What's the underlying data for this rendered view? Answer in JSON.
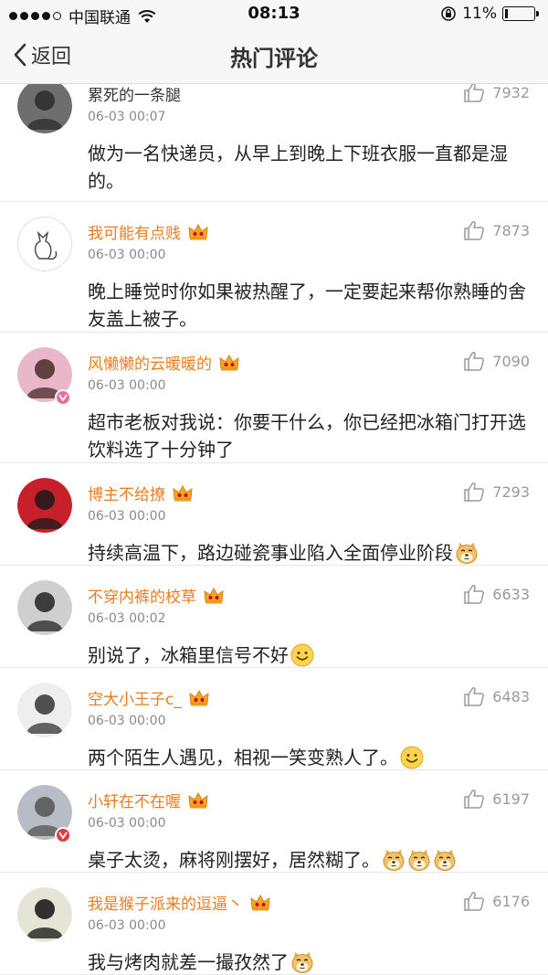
{
  "status_bar": {
    "carrier": "中国联通",
    "time": "08:13",
    "battery_text": "11%",
    "battery_level": 0.11
  },
  "nav": {
    "back_label": "返回",
    "title": "热门评论"
  },
  "comments": [
    {
      "user": "累死的一条腿",
      "vip": false,
      "time": "06-03 00:07",
      "likes": "7932",
      "text": "做为一名快递员，从早上到晚上下班衣服一直都是湿的。",
      "emojis": []
    },
    {
      "user": "我可能有点贱",
      "vip": true,
      "time": "06-03 00:00",
      "likes": "7873",
      "text": "晚上睡觉时你如果被热醒了，一定要起来帮你熟睡的舍友盖上被子。",
      "emojis": []
    },
    {
      "user": "风懒懒的云暖暖的",
      "vip": true,
      "time": "06-03 00:00",
      "likes": "7090",
      "text": "超市老板对我说：你要干什么，你已经把冰箱门打开选饮料选了十分钟了",
      "emojis": []
    },
    {
      "user": "博主不给撩",
      "vip": true,
      "time": "06-03 00:00",
      "likes": "7293",
      "text": "持续高温下，路边碰瓷事业陷入全面停业阶段",
      "emojis": [
        "doge-emoji"
      ]
    },
    {
      "user": "不穿内裤的校草",
      "vip": true,
      "time": "06-03 00:02",
      "likes": "6633",
      "text": "别说了，冰箱里信号不好",
      "emojis": [
        "smile-emoji"
      ]
    },
    {
      "user": "空大小王子c_",
      "vip": true,
      "time": "06-03 00:00",
      "likes": "6483",
      "text": "两个陌生人遇见，相视一笑变熟人了。",
      "emojis": [
        "smile-emoji"
      ]
    },
    {
      "user": "小轩在不在喔",
      "vip": true,
      "time": "06-03 00:00",
      "likes": "6197",
      "text": "桌子太烫，麻将刚摆好，居然糊了。",
      "emojis": [
        "doge-emoji",
        "doge-emoji",
        "doge-emoji"
      ]
    },
    {
      "user": "我是猴子派来的逗逼丶",
      "vip": true,
      "time": "06-03 00:00",
      "likes": "6176",
      "text": "我与烤肉就差一撮孜然了",
      "emojis": [
        "doge-emoji"
      ]
    }
  ],
  "colors": {
    "vip_name": "#e87c1e",
    "normal_name": "#333333",
    "meta": "#8a8a8a"
  }
}
